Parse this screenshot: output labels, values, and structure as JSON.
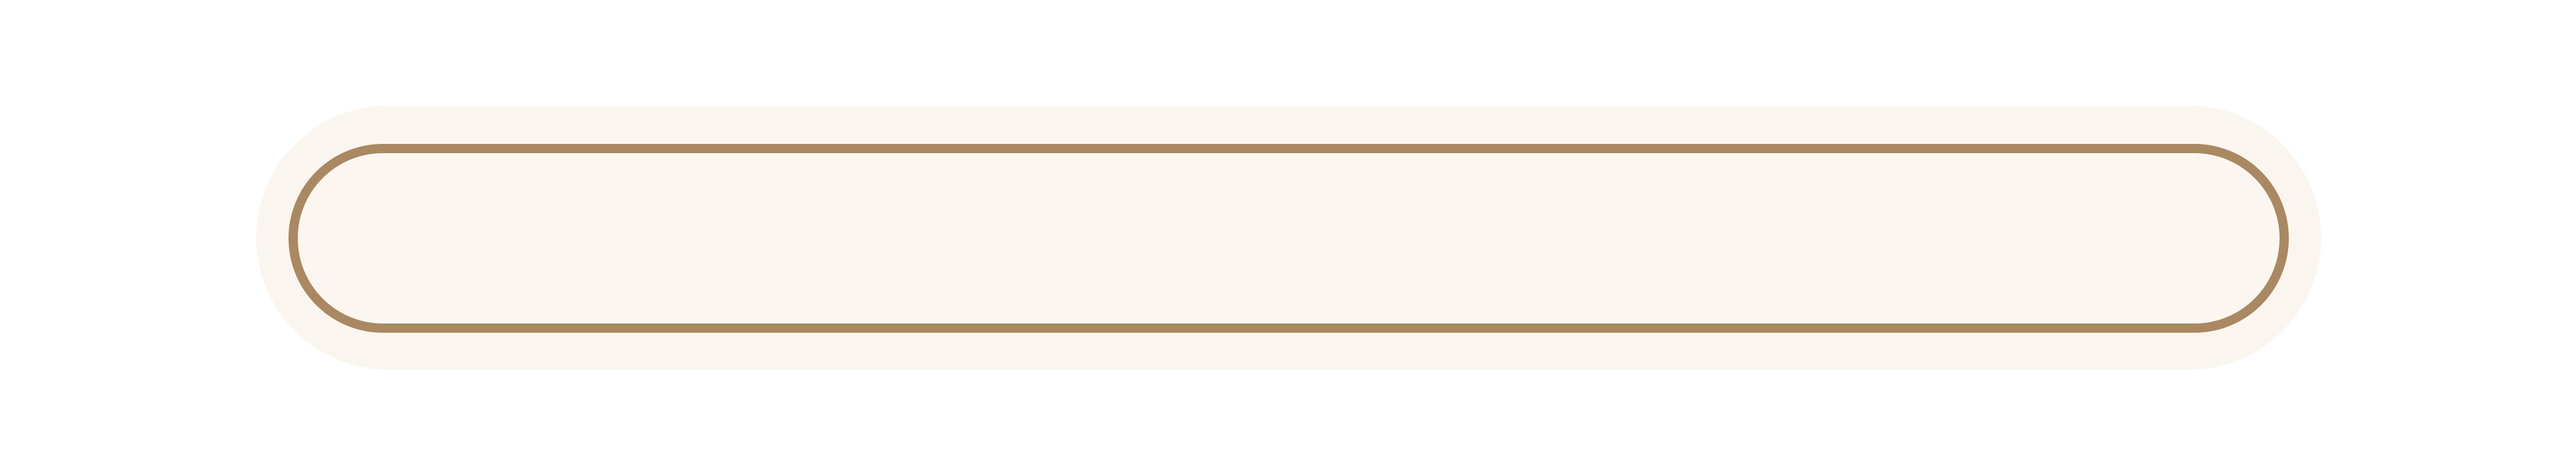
{
  "colors": {
    "background": "#ffffff",
    "outer_fill": "#faf6ef",
    "inner_fill": "#fbf7f0",
    "inner_border": "#a98862"
  },
  "text_field": {
    "value": ""
  }
}
